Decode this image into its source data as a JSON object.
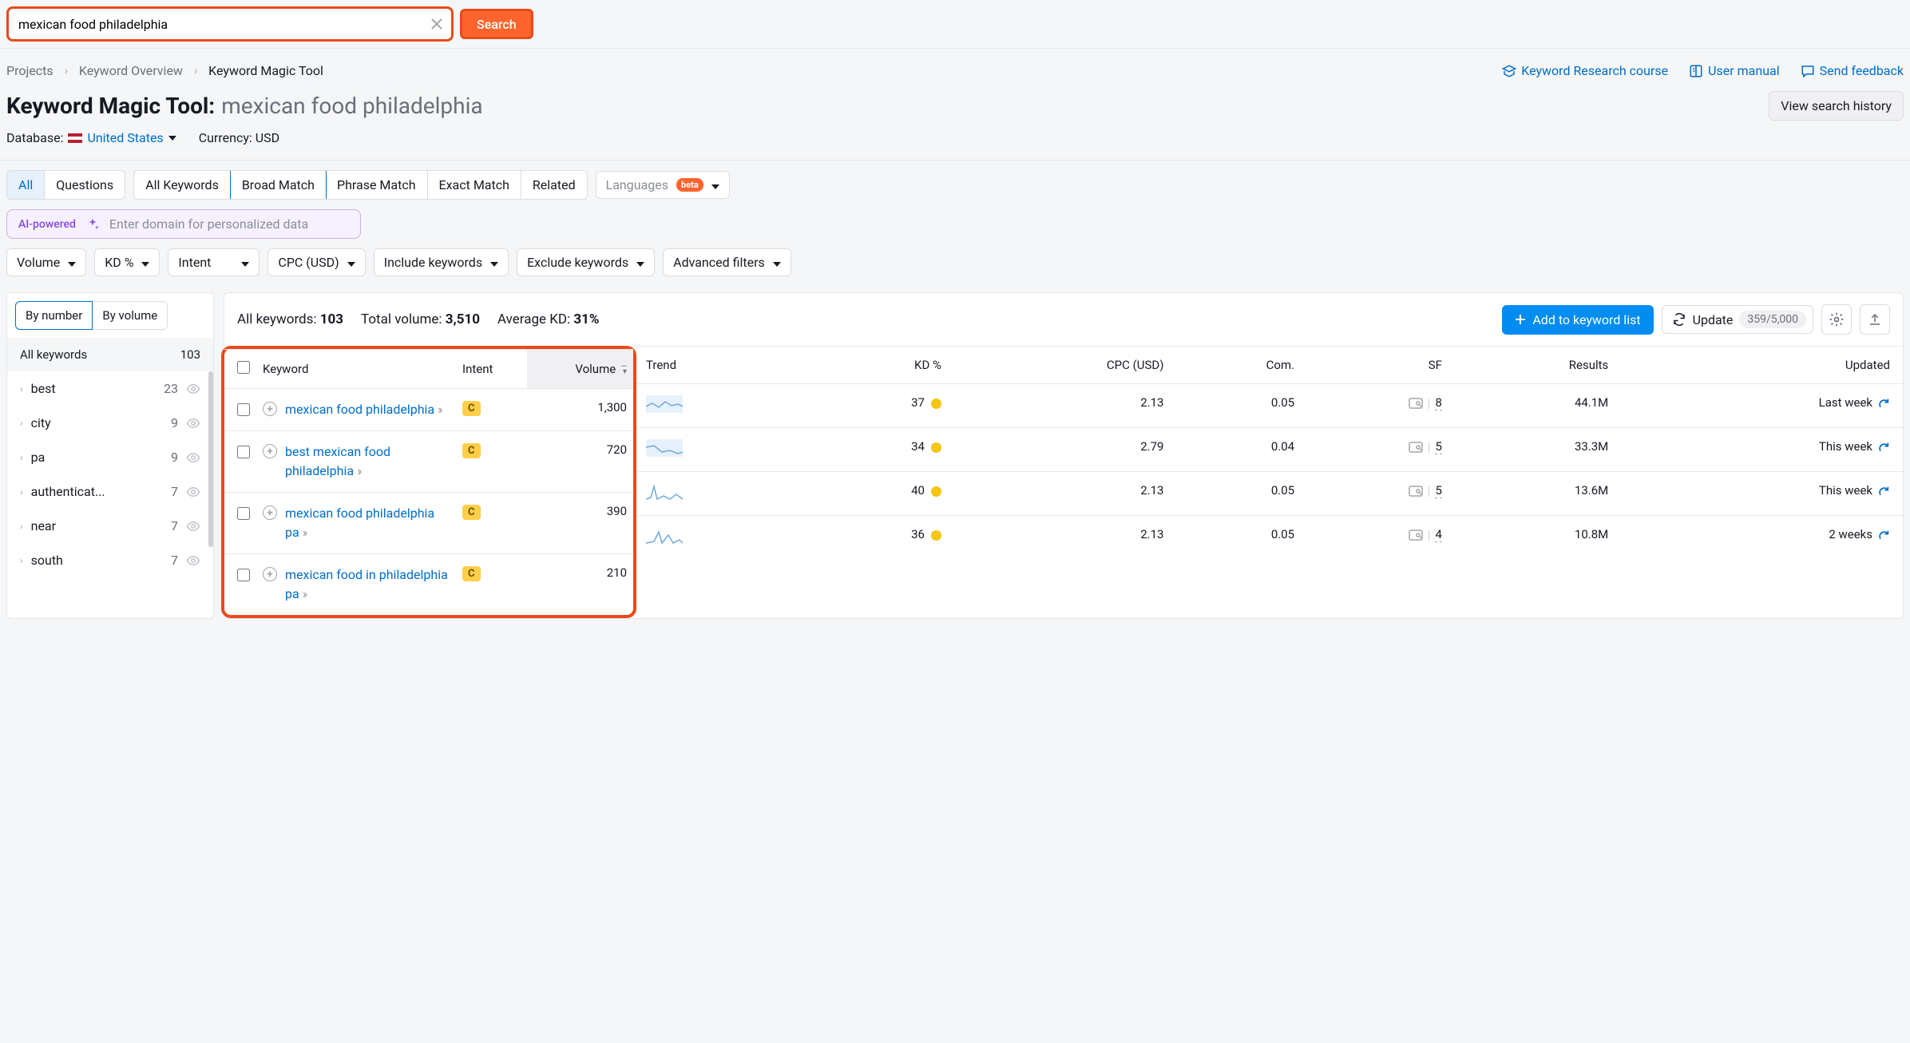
{
  "search": {
    "value": "mexican food philadelphia",
    "button": "Search"
  },
  "breadcrumbs": {
    "items": [
      "Projects",
      "Keyword Overview",
      "Keyword Magic Tool"
    ]
  },
  "top_links": {
    "research_course": "Keyword Research course",
    "user_manual": "User manual",
    "send_feedback": "Send feedback"
  },
  "title": {
    "tool": "Keyword Magic Tool:",
    "query": "mexican food philadelphia",
    "history_btn": "View search history"
  },
  "meta": {
    "db_label": "Database:",
    "db_value": "United States",
    "currency_label": "Currency:",
    "currency_value": "USD"
  },
  "match_tabs": {
    "all": "All",
    "questions": "Questions",
    "all_keywords": "All Keywords",
    "broad": "Broad Match",
    "phrase": "Phrase Match",
    "exact": "Exact Match",
    "related": "Related",
    "languages": "Languages",
    "beta": "beta"
  },
  "ai": {
    "label": "AI-powered",
    "placeholder": "Enter domain for personalized data"
  },
  "filters": {
    "volume": "Volume",
    "kd": "KD %",
    "intent": "Intent",
    "cpc": "CPC (USD)",
    "include": "Include keywords",
    "exclude": "Exclude keywords",
    "advanced": "Advanced filters"
  },
  "sidebar": {
    "sort_number": "By number",
    "sort_volume": "By volume",
    "header_label": "All keywords",
    "header_count": "103",
    "items": [
      {
        "label": "best",
        "count": "23"
      },
      {
        "label": "city",
        "count": "9"
      },
      {
        "label": "pa",
        "count": "9"
      },
      {
        "label": "authenticat...",
        "count": "7"
      },
      {
        "label": "near",
        "count": "7"
      },
      {
        "label": "south",
        "count": "7"
      }
    ]
  },
  "content_header": {
    "all_kw_label": "All keywords:",
    "all_kw_value": "103",
    "total_vol_label": "Total volume:",
    "total_vol_value": "3,510",
    "avg_kd_label": "Average KD:",
    "avg_kd_value": "31%",
    "add_btn": "Add to keyword list",
    "update_btn": "Update",
    "quota": "359/5,000"
  },
  "columns": {
    "keyword": "Keyword",
    "intent": "Intent",
    "volume": "Volume",
    "trend": "Trend",
    "kd": "KD %",
    "cpc": "CPC (USD)",
    "com": "Com.",
    "sf": "SF",
    "results": "Results",
    "updated": "Updated"
  },
  "rows": [
    {
      "keyword": "mexican food philadelphia",
      "intent": "C",
      "volume": "1,300",
      "kd": "37",
      "cpc": "2.13",
      "com": "0.05",
      "sf": "8",
      "results": "44.1M",
      "updated": "Last week"
    },
    {
      "keyword": "best mexican food philadelphia",
      "intent": "C",
      "volume": "720",
      "kd": "34",
      "cpc": "2.79",
      "com": "0.04",
      "sf": "5",
      "results": "33.3M",
      "updated": "This week"
    },
    {
      "keyword": "mexican food philadelphia pa",
      "intent": "C",
      "volume": "390",
      "kd": "40",
      "cpc": "2.13",
      "com": "0.05",
      "sf": "5",
      "results": "13.6M",
      "updated": "This week"
    },
    {
      "keyword": "mexican food in philadelphia pa",
      "intent": "C",
      "volume": "210",
      "kd": "36",
      "cpc": "2.13",
      "com": "0.05",
      "sf": "4",
      "results": "10.8M",
      "updated": "2 weeks"
    }
  ]
}
